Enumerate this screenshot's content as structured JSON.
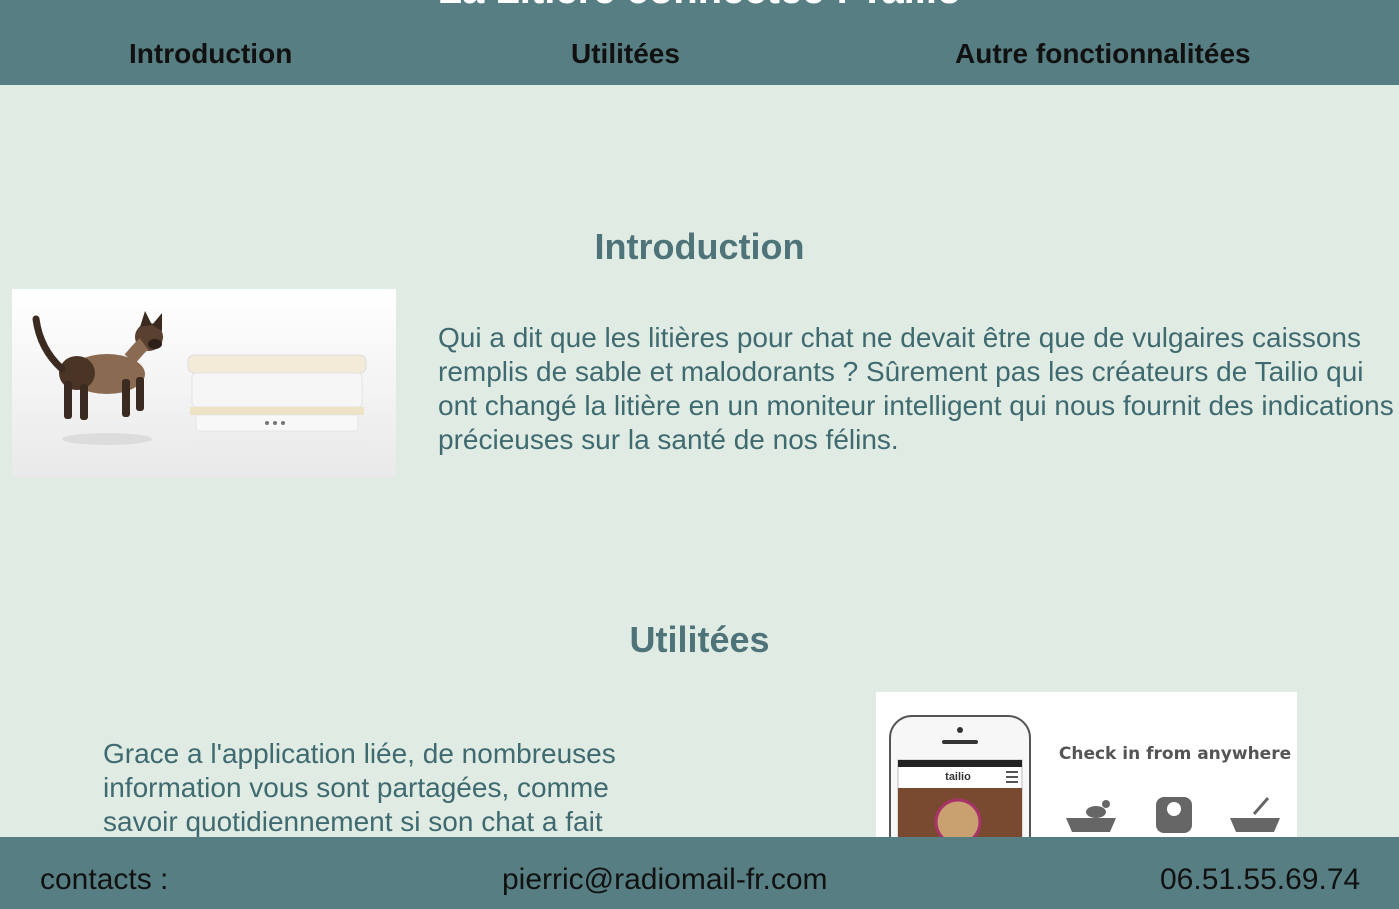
{
  "header": {
    "title": "La Litière connectée : Tailio",
    "nav": [
      {
        "label": "Introduction"
      },
      {
        "label": "Utilitées"
      },
      {
        "label": "Autre fonctionnalitées"
      }
    ]
  },
  "intro": {
    "heading": "Introduction",
    "text": "Qui a dit que les litières pour chat ne devait être que de vulgaires caissons remplis de sable et malodorants ? Sûrement pas les créateurs de Tailio qui ont changé la litière en un moniteur intelligent qui nous fournit des indications précieuses sur la santé de nos félins."
  },
  "utilities": {
    "heading": "Utilitées",
    "text": "Grace a l'application liée, de nombreuses information vous sont partagées, comme savoir quotidiennement si son chat a fait",
    "image": {
      "caption": "Check in from anywhere",
      "phone_logo": "tailio"
    }
  },
  "footer": {
    "contacts_label": "contacts :",
    "email": "pierric@radiomail-fr.com",
    "phone": "06.51.55.69.74"
  },
  "colors": {
    "header_bg": "#577f83",
    "page_bg": "#e0ebe3",
    "heading": "#4e7378",
    "text": "#3f6a70"
  }
}
